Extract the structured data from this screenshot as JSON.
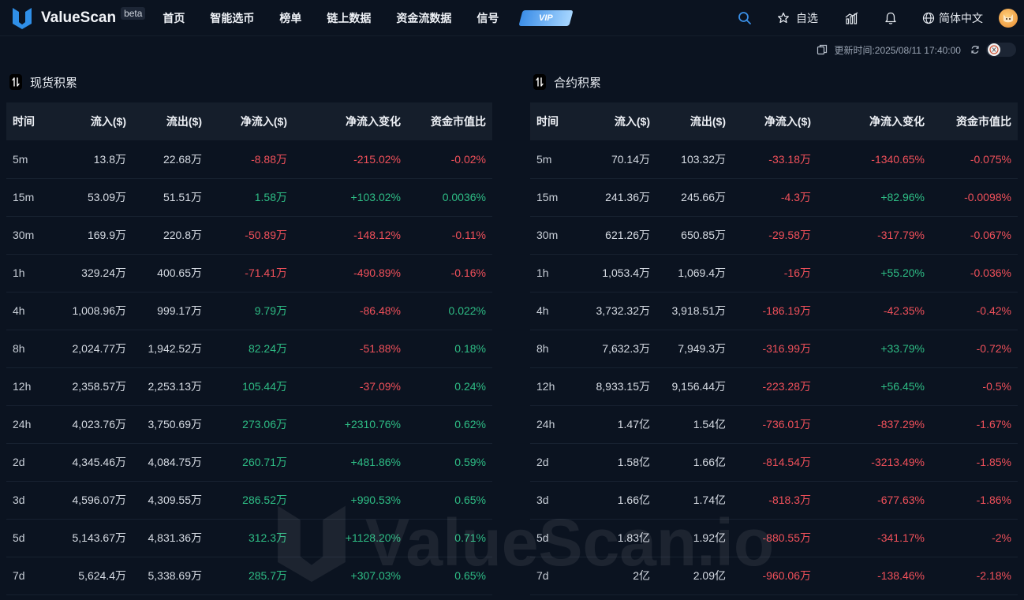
{
  "brand": {
    "name": "ValueScan",
    "badge": "beta"
  },
  "nav": {
    "items": [
      "首页",
      "智能选币",
      "榜单",
      "链上数据",
      "资金流数据",
      "信号"
    ],
    "vip": "VIP"
  },
  "toolbar": {
    "watchlist": "自选",
    "language": "简体中文"
  },
  "update": {
    "text": "更新时间:2025/08/11 17:40:00"
  },
  "colors": {
    "negative": "#f0505a",
    "positive": "#2ebd85",
    "accent": "#2f7fe0"
  },
  "headers": [
    "时间",
    "流入($)",
    "流出($)",
    "净流入($)",
    "净流入变化",
    "资金市值比"
  ],
  "spot": {
    "title": "现货积累",
    "rows": [
      [
        "5m",
        "13.8万",
        "22.68万",
        "-8.88万",
        "-215.02%",
        "-0.02%"
      ],
      [
        "15m",
        "53.09万",
        "51.51万",
        "1.58万",
        "+103.02%",
        "0.0036%"
      ],
      [
        "30m",
        "169.9万",
        "220.8万",
        "-50.89万",
        "-148.12%",
        "-0.11%"
      ],
      [
        "1h",
        "329.24万",
        "400.65万",
        "-71.41万",
        "-490.89%",
        "-0.16%"
      ],
      [
        "4h",
        "1,008.96万",
        "999.17万",
        "9.79万",
        "-86.48%",
        "0.022%"
      ],
      [
        "8h",
        "2,024.77万",
        "1,942.52万",
        "82.24万",
        "-51.88%",
        "0.18%"
      ],
      [
        "12h",
        "2,358.57万",
        "2,253.13万",
        "105.44万",
        "-37.09%",
        "0.24%"
      ],
      [
        "24h",
        "4,023.76万",
        "3,750.69万",
        "273.06万",
        "+2310.76%",
        "0.62%"
      ],
      [
        "2d",
        "4,345.46万",
        "4,084.75万",
        "260.71万",
        "+481.86%",
        "0.59%"
      ],
      [
        "3d",
        "4,596.07万",
        "4,309.55万",
        "286.52万",
        "+990.53%",
        "0.65%"
      ],
      [
        "5d",
        "5,143.67万",
        "4,831.36万",
        "312.3万",
        "+1128.20%",
        "0.71%"
      ],
      [
        "7d",
        "5,624.4万",
        "5,338.69万",
        "285.7万",
        "+307.03%",
        "0.65%"
      ]
    ]
  },
  "futures": {
    "title": "合约积累",
    "rows": [
      [
        "5m",
        "70.14万",
        "103.32万",
        "-33.18万",
        "-1340.65%",
        "-0.075%"
      ],
      [
        "15m",
        "241.36万",
        "245.66万",
        "-4.3万",
        "+82.96%",
        "-0.0098%"
      ],
      [
        "30m",
        "621.26万",
        "650.85万",
        "-29.58万",
        "-317.79%",
        "-0.067%"
      ],
      [
        "1h",
        "1,053.4万",
        "1,069.4万",
        "-16万",
        "+55.20%",
        "-0.036%"
      ],
      [
        "4h",
        "3,732.32万",
        "3,918.51万",
        "-186.19万",
        "-42.35%",
        "-0.42%"
      ],
      [
        "8h",
        "7,632.3万",
        "7,949.3万",
        "-316.99万",
        "+33.79%",
        "-0.72%"
      ],
      [
        "12h",
        "8,933.15万",
        "9,156.44万",
        "-223.28万",
        "+56.45%",
        "-0.5%"
      ],
      [
        "24h",
        "1.47亿",
        "1.54亿",
        "-736.01万",
        "-837.29%",
        "-1.67%"
      ],
      [
        "2d",
        "1.58亿",
        "1.66亿",
        "-814.54万",
        "-3213.49%",
        "-1.85%"
      ],
      [
        "3d",
        "1.66亿",
        "1.74亿",
        "-818.3万",
        "-677.63%",
        "-1.86%"
      ],
      [
        "5d",
        "1.83亿",
        "1.92亿",
        "-880.55万",
        "-341.17%",
        "-2%"
      ],
      [
        "7d",
        "2亿",
        "2.09亿",
        "-960.06万",
        "-138.46%",
        "-2.18%"
      ]
    ]
  },
  "watermark": "ValueScan.io"
}
